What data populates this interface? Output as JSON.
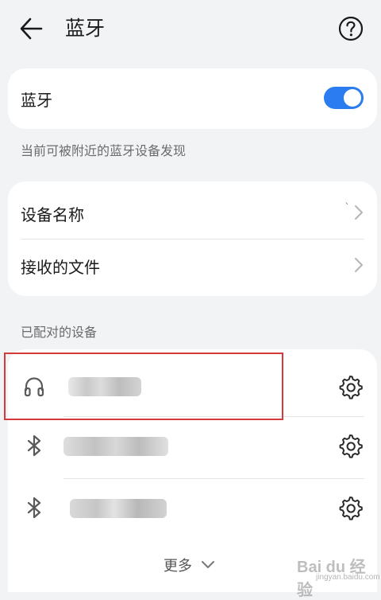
{
  "header": {
    "title": "蓝牙",
    "back_icon": "arrow-left-icon",
    "help_icon": "question-circle-icon"
  },
  "bluetooth": {
    "label": "蓝牙",
    "toggle_on": true,
    "visibility_text": "当前可被附近的蓝牙设备发现"
  },
  "info": {
    "device_name_label": "设备名称",
    "device_name_value": "`",
    "received_files_label": "接收的文件"
  },
  "paired": {
    "section_title": "已配对的设备",
    "devices": [
      {
        "icon": "headphones-icon"
      },
      {
        "icon": "bluetooth-icon"
      },
      {
        "icon": "bluetooth-icon"
      }
    ],
    "more_label": "更多"
  },
  "watermark": {
    "text": "Bai du 经验",
    "sub": "jingyan.baidu.com"
  },
  "colors": {
    "accent": "#2a7cf0",
    "highlight": "#d33a3a",
    "background": "#f1f3f5"
  }
}
